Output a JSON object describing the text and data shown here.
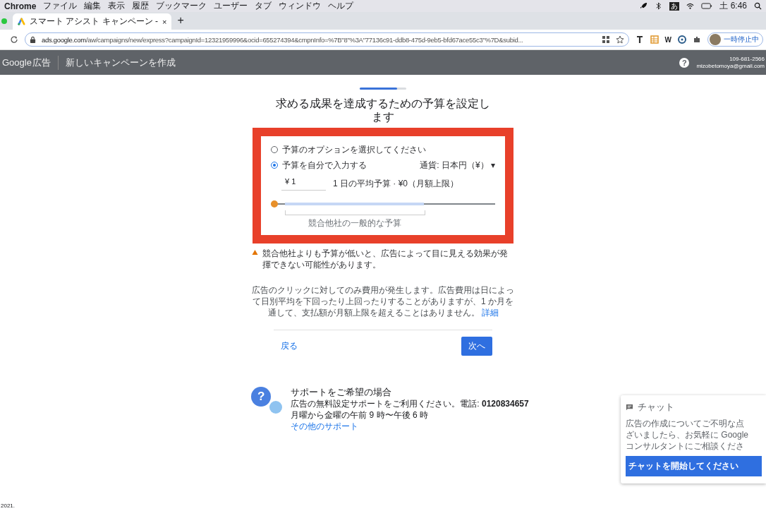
{
  "menubar": {
    "app": "Chrome",
    "items": [
      "ファイル",
      "編集",
      "表示",
      "履歴",
      "ブックマーク",
      "ユーザー",
      "タブ",
      "ウィンドウ",
      "ヘルプ"
    ],
    "ime": "あ",
    "clock": "土 6:46"
  },
  "browser": {
    "tab_title": "スマート アシスト キャンペーン -",
    "tab_close": "×",
    "new_tab": "+",
    "url_host": "ads.google.com",
    "url_path": "/aw/campaigns/new/express?campaignId=12321959996&ocid=655274394&cmpnInfo=%7B\"8\"%3A\"77136c91-ddb8-475d-9eb5-bfd67ace55c3\"%7D&subid...",
    "ext_text": "W",
    "profile_label": "一時停止中"
  },
  "header": {
    "logo": "Google",
    "logo_suffix": "広告",
    "title": "新しいキャンペーンを作成",
    "help_glyph": "?",
    "account_id": "109-681-2566",
    "email": "mizobetomoya@gmail.com"
  },
  "progress": {
    "level": 0.8
  },
  "heading": "求める成果を達成するための予算を設定します",
  "options": [
    {
      "label": "予算のオプションを選択してください",
      "selected": false
    },
    {
      "label": "予算を自分で入力する",
      "selected": true
    }
  ],
  "currency": "通貨: 日本円（¥）",
  "currency_caret": "▾",
  "budget": {
    "value": "¥ 1",
    "note": "1 日の平均予算 · ¥0（月額上限）",
    "level": 0,
    "range_label": "競合他社の一般的な予算"
  },
  "warning": "競合他社よりも予算が低いと、広告によって目に見える効果が発揮できない可能性があります。",
  "info": "広告のクリックに対してのみ費用が発生します。広告費用は日によって日別平均を下回ったり上回ったりすることがありますが、1 か月を通して、支払額が月額上限を超えることはありません。",
  "info_link": "詳細",
  "back": "戻る",
  "next": "次へ",
  "support": {
    "glyph": "?",
    "title": "サポートをご希望の場合",
    "line": "広告の無料設定サポートをご利用ください。電話: **0120834657**",
    "hours": "月曜から金曜の午前 9 時〜午後 6 時",
    "link": "その他のサポート"
  },
  "chat": {
    "title": "チャット",
    "lines": [
      "広告の作成についてご不明な点",
      "ざいましたら、お気軽に Google",
      "コンサルタントにご相談くださ"
    ],
    "button": "チャットを開始してください"
  },
  "footer": "2021."
}
